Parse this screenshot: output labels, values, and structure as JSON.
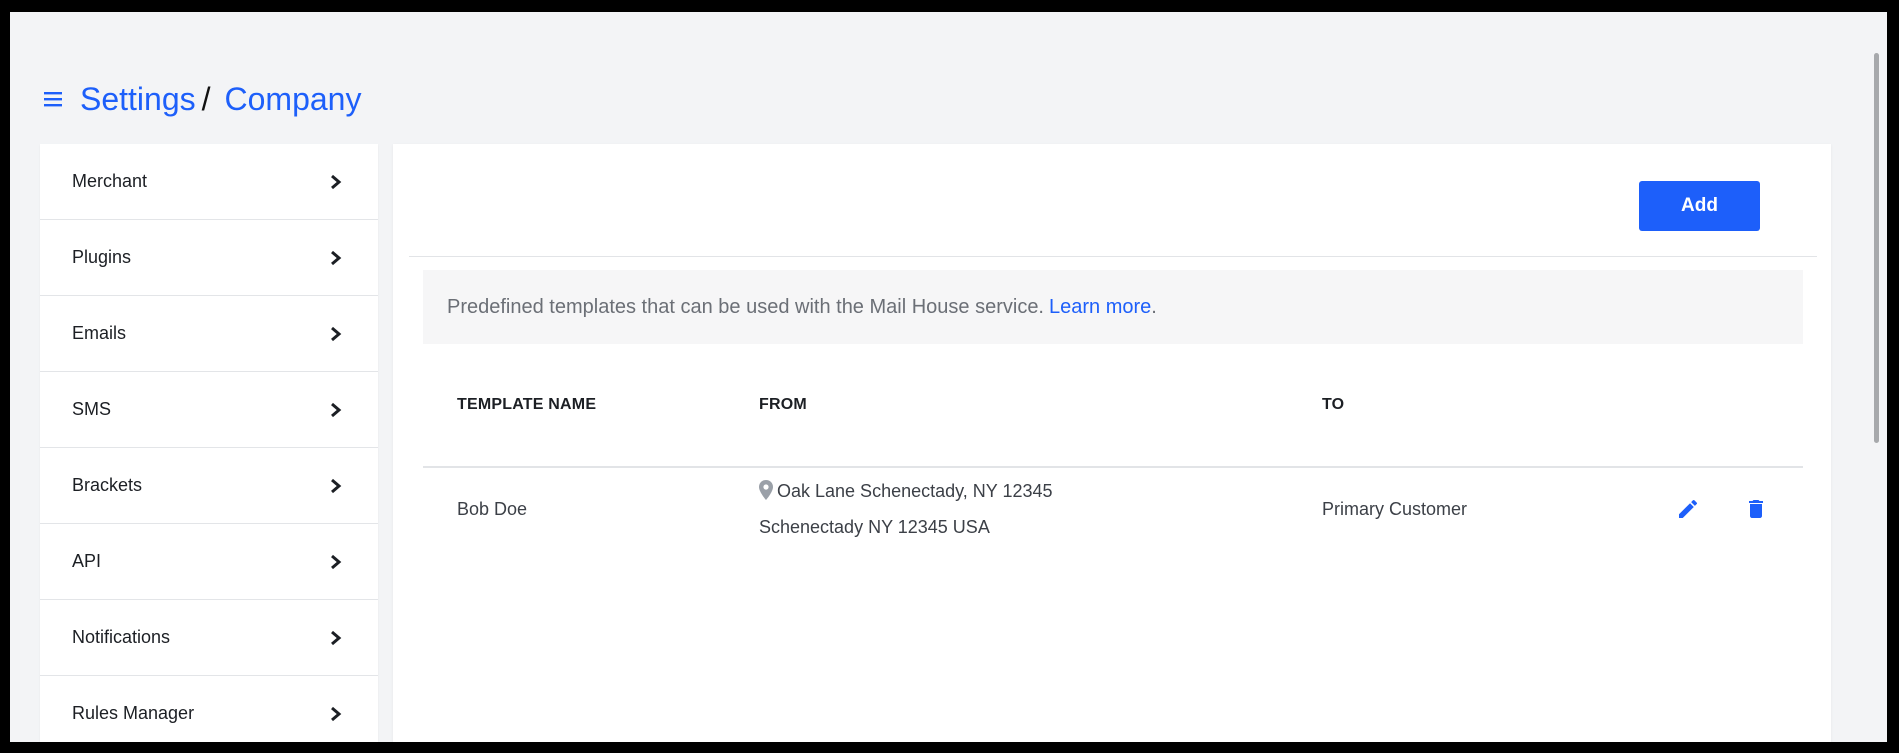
{
  "header": {
    "menu_icon": "hamburger-menu-icon",
    "breadcrumb": [
      "Settings",
      "Company"
    ],
    "separator": "/"
  },
  "sidebar": {
    "items": [
      {
        "label": "Merchant",
        "icon": "chevron-right-icon"
      },
      {
        "label": "Plugins",
        "icon": "chevron-right-icon"
      },
      {
        "label": "Emails",
        "icon": "chevron-right-icon"
      },
      {
        "label": "SMS",
        "icon": "chevron-right-icon"
      },
      {
        "label": "Brackets",
        "icon": "chevron-right-icon"
      },
      {
        "label": "API",
        "icon": "chevron-right-icon"
      },
      {
        "label": "Notifications",
        "icon": "chevron-right-icon"
      },
      {
        "label": "Rules Manager",
        "icon": "chevron-right-icon"
      }
    ]
  },
  "main": {
    "add_label": "Add",
    "info_text": "Predefined templates that can be used with the Mail House service.",
    "info_link": "Learn more",
    "info_suffix": ".",
    "table": {
      "headers": [
        "TEMPLATE NAME",
        "FROM",
        "TO"
      ],
      "rows": [
        {
          "name": "Bob Doe",
          "from_line1": "Oak Lane Schenectady, NY 12345",
          "from_line2": "Schenectady NY 12345 USA",
          "to": "Primary Customer",
          "actions": [
            "edit-icon",
            "delete-icon"
          ]
        }
      ]
    }
  },
  "colors": {
    "accent": "#1d5ffa",
    "background": "#f3f4f6",
    "panel": "#ffffff"
  }
}
